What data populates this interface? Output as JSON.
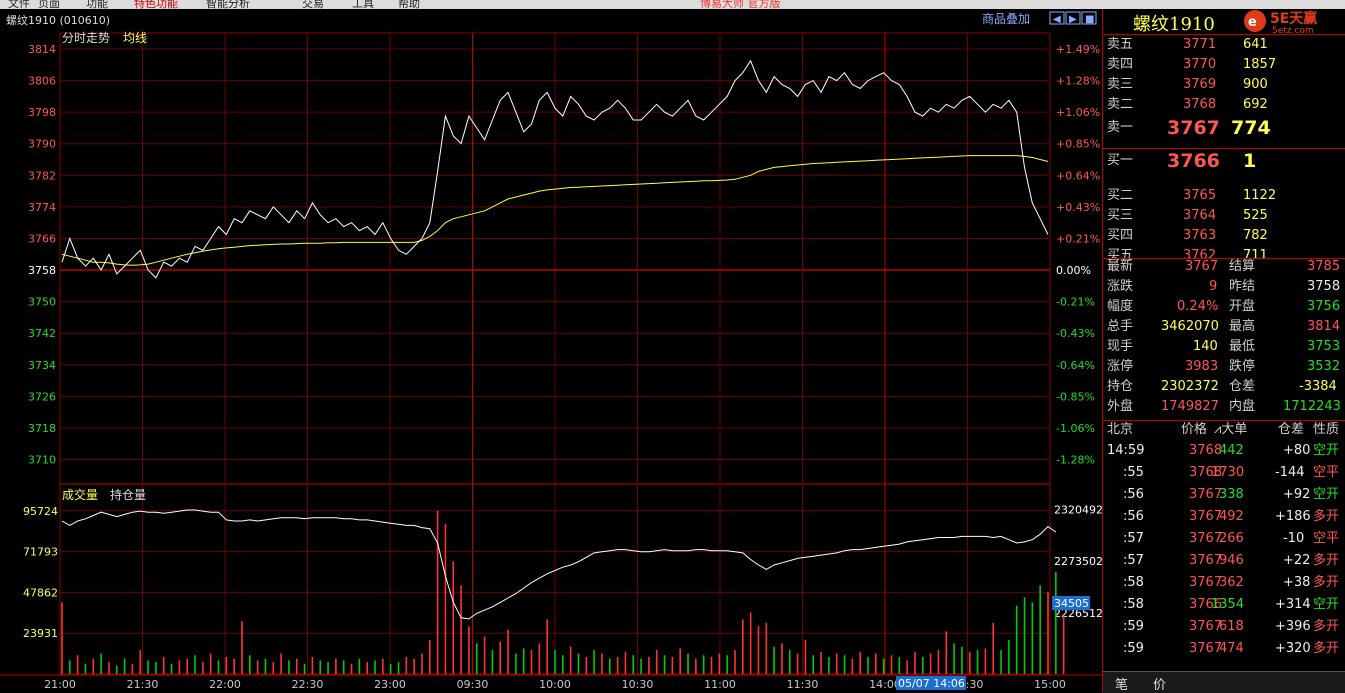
{
  "top_menu": [
    "文件",
    "页面",
    "功能",
    "特色功能",
    "智能分析",
    "交易",
    "工具",
    "帮助"
  ],
  "top_banner": "博易大师 官方版",
  "chart": {
    "title": "螺纹1910 (010610)",
    "legend_price": "分时走势",
    "legend_avg": "均线",
    "top_right_button": "商品叠加",
    "price_ticks": [
      "3814",
      "3806",
      "3798",
      "3790",
      "3782",
      "3774",
      "3766",
      "3758",
      "3750",
      "3742",
      "3734",
      "3726",
      "3718",
      "3710"
    ],
    "pct_ticks": [
      "+1.49%",
      "+1.28%",
      "+1.06%",
      "+0.85%",
      "+0.64%",
      "+0.43%",
      "+0.21%",
      "0.00%",
      "-0.21%",
      "-0.43%",
      "-0.64%",
      "-0.85%",
      "-1.06%",
      "-1.28%"
    ],
    "vol_legend_volume": "成交量",
    "vol_legend_oi": "持仓量",
    "vol_ticks_left": [
      "95724",
      "71793",
      "47862",
      "23931"
    ],
    "vol_ticks_right": [
      "2320492",
      "2273502",
      "2226512"
    ],
    "vol_current": "34505",
    "time_ticks": [
      "21:00",
      "21:30",
      "22:00",
      "22:30",
      "23:00",
      "09:30",
      "10:00",
      "10:30",
      "11:00",
      "11:30",
      "14:00",
      "14:30",
      "15:00"
    ],
    "cursor_label": "05/07 14:06",
    "colors": {
      "price_line": "#ffffff",
      "avg_line": "#ffff33",
      "grid": "#8b0000",
      "up": "#ff3333",
      "down": "#00cc00"
    }
  },
  "chart_data": {
    "type": "line",
    "price_axis": {
      "min": 3706,
      "max": 3814,
      "prev_settle": 3758
    },
    "price_series": [
      3760,
      3766,
      3761,
      3759,
      3761,
      3758,
      3762,
      3757,
      3759,
      3761,
      3763,
      3758,
      3756,
      3760,
      3759,
      3761,
      3760,
      3764,
      3763,
      3766,
      3769,
      3767,
      3771,
      3770,
      3773,
      3772,
      3771,
      3774,
      3772,
      3770,
      3773,
      3771,
      3775,
      3772,
      3770,
      3771,
      3769,
      3770,
      3768,
      3769,
      3767,
      3770,
      3766,
      3763,
      3762,
      3764,
      3766,
      3770,
      3783,
      3797,
      3792,
      3790,
      3797,
      3794,
      3791,
      3796,
      3801,
      3803,
      3798,
      3793,
      3795,
      3801,
      3803,
      3799,
      3797,
      3802,
      3800,
      3797,
      3796,
      3798,
      3799,
      3801,
      3799,
      3796,
      3796,
      3798,
      3800,
      3798,
      3797,
      3799,
      3801,
      3797,
      3796,
      3798,
      3800,
      3802,
      3806,
      3808,
      3811,
      3806,
      3803,
      3807,
      3805,
      3804,
      3802,
      3805,
      3806,
      3803,
      3807,
      3806,
      3808,
      3805,
      3804,
      3806,
      3807,
      3808,
      3806,
      3805,
      3802,
      3798,
      3797,
      3799,
      3798,
      3800,
      3799,
      3801,
      3802,
      3800,
      3798,
      3800,
      3799,
      3801,
      3798,
      3784,
      3775,
      3771,
      3767
    ],
    "avg_series": [
      3762,
      3761.5,
      3761,
      3760.5,
      3760,
      3760,
      3759.8,
      3759.5,
      3759.3,
      3759.2,
      3759.3,
      3759.5,
      3760,
      3760.5,
      3761,
      3761.5,
      3762,
      3762.4,
      3762.8,
      3763.1,
      3763.4,
      3763.6,
      3763.8,
      3764,
      3764.2,
      3764.3,
      3764.4,
      3764.5,
      3764.6,
      3764.6,
      3764.7,
      3764.8,
      3764.8,
      3764.8,
      3764.9,
      3764.9,
      3765,
      3765,
      3765,
      3765,
      3765,
      3765,
      3765,
      3765,
      3765,
      3765,
      3765.5,
      3766.5,
      3768,
      3770,
      3771,
      3771.5,
      3772,
      3772.5,
      3773,
      3774,
      3775,
      3776,
      3776.5,
      3777,
      3777.5,
      3778,
      3778.3,
      3778.5,
      3778.7,
      3778.9,
      3779,
      3779.1,
      3779.2,
      3779.3,
      3779.4,
      3779.5,
      3779.6,
      3779.7,
      3779.8,
      3779.9,
      3780,
      3780.1,
      3780.2,
      3780.3,
      3780.4,
      3780.5,
      3780.6,
      3780.6,
      3780.7,
      3780.8,
      3781,
      3781.5,
      3782,
      3783,
      3783.5,
      3784,
      3784.2,
      3784.4,
      3784.6,
      3784.8,
      3785,
      3785.1,
      3785.2,
      3785.3,
      3785.4,
      3785.5,
      3785.6,
      3785.7,
      3785.8,
      3785.9,
      3786,
      3786.1,
      3786.2,
      3786.3,
      3786.4,
      3786.5,
      3786.6,
      3786.7,
      3786.8,
      3786.9,
      3787,
      3787,
      3787,
      3787,
      3787,
      3787,
      3787,
      3786.8,
      3786.5,
      3786,
      3785.5
    ],
    "oi_axis": {
      "min": 2180000,
      "max": 2330000
    },
    "oi_series": [
      2310000,
      2306000,
      2310000,
      2312000,
      2315000,
      2318000,
      2316000,
      2314000,
      2316000,
      2318000,
      2319000,
      2318000,
      2318000,
      2317000,
      2318000,
      2319000,
      2320000,
      2320000,
      2319000,
      2318000,
      2318000,
      2311000,
      2310000,
      2310000,
      2311000,
      2310000,
      2311000,
      2312000,
      2313000,
      2313000,
      2313000,
      2312000,
      2313000,
      2313000,
      2313000,
      2313000,
      2312000,
      2312000,
      2311000,
      2311000,
      2310000,
      2309000,
      2308000,
      2307000,
      2306000,
      2306000,
      2304000,
      2303000,
      2290000,
      2260000,
      2236000,
      2222000,
      2221000,
      2226000,
      2229000,
      2232000,
      2236000,
      2240000,
      2244000,
      2249000,
      2254000,
      2258000,
      2262000,
      2265000,
      2268000,
      2270000,
      2273000,
      2277000,
      2281000,
      2282000,
      2283000,
      2284000,
      2284000,
      2283000,
      2282000,
      2282000,
      2283000,
      2284000,
      2283000,
      2283000,
      2283000,
      2284000,
      2284000,
      2283000,
      2283000,
      2283000,
      2282000,
      2281000,
      2275000,
      2270000,
      2266000,
      2270000,
      2272000,
      2274000,
      2276000,
      2277000,
      2278000,
      2279000,
      2280000,
      2281000,
      2283000,
      2284000,
      2284000,
      2285000,
      2286000,
      2287000,
      2288000,
      2289000,
      2291000,
      2292000,
      2293000,
      2294000,
      2295000,
      2295000,
      2295000,
      2296000,
      2296000,
      2296000,
      2296000,
      2295000,
      2296000,
      2293000,
      2290000,
      2291000,
      2293000,
      2298000,
      2305000,
      2300000
    ],
    "vol_axis": {
      "max": 95724
    },
    "volume_series": [
      42000,
      8000,
      11000,
      6000,
      9000,
      12000,
      7000,
      5000,
      9000,
      6000,
      14000,
      8000,
      7000,
      10000,
      6000,
      8000,
      9000,
      11000,
      7000,
      12000,
      8000,
      10000,
      9000,
      31000,
      11000,
      8000,
      9000,
      7000,
      12000,
      8000,
      9000,
      6000,
      10000,
      8000,
      7000,
      9000,
      8000,
      6000,
      9000,
      7000,
      8000,
      9000,
      6000,
      7000,
      10000,
      9000,
      12000,
      20000,
      95724,
      88000,
      66000,
      52000,
      28000,
      18000,
      22000,
      14000,
      19000,
      26000,
      12000,
      15000,
      14000,
      18000,
      32000,
      14000,
      11000,
      16000,
      12000,
      10000,
      14000,
      12000,
      9000,
      10000,
      13000,
      11000,
      9000,
      10000,
      14000,
      11000,
      10000,
      15000,
      12000,
      9000,
      11000,
      10000,
      12000,
      11000,
      14000,
      32000,
      36000,
      28000,
      30000,
      16000,
      18000,
      14000,
      12000,
      20000,
      11000,
      13000,
      10000,
      12000,
      11000,
      9000,
      13000,
      10000,
      12000,
      9000,
      11000,
      10000,
      8000,
      13000,
      10000,
      12000,
      14000,
      25000,
      18000,
      16000,
      13000,
      14000,
      15000,
      30000,
      14000,
      20000,
      40000,
      45000,
      42000,
      52000,
      48000,
      60000,
      34505
    ],
    "volume_dir": [
      1,
      0,
      1,
      0,
      1,
      0,
      1,
      0,
      0,
      1,
      1,
      0,
      0,
      1,
      0,
      1,
      1,
      0,
      1,
      1,
      0,
      1,
      1,
      1,
      0,
      1,
      0,
      1,
      1,
      0,
      1,
      0,
      1,
      0,
      0,
      1,
      0,
      1,
      0,
      1,
      0,
      1,
      0,
      0,
      1,
      1,
      1,
      1,
      1,
      1,
      1,
      1,
      1,
      0,
      1,
      0,
      1,
      1,
      0,
      0,
      1,
      1,
      1,
      0,
      0,
      1,
      0,
      1,
      0,
      1,
      0,
      1,
      1,
      0,
      0,
      1,
      1,
      0,
      1,
      1,
      0,
      1,
      0,
      1,
      1,
      0,
      1,
      1,
      1,
      1,
      1,
      0,
      1,
      0,
      1,
      1,
      0,
      1,
      0,
      1,
      0,
      1,
      1,
      0,
      1,
      0,
      1,
      0,
      1,
      1,
      0,
      1,
      1,
      1,
      0,
      0,
      1,
      0,
      1,
      1,
      0,
      0,
      0,
      0,
      0,
      0,
      1,
      0,
      1
    ]
  },
  "side": {
    "symbol": "螺纹1910",
    "logo": "5E天赢",
    "logo_sub": "5etz.com",
    "asks": [
      {
        "label": "卖五",
        "price": "3771",
        "qty": "641"
      },
      {
        "label": "卖四",
        "price": "3770",
        "qty": "1857"
      },
      {
        "label": "卖三",
        "price": "3769",
        "qty": "900"
      },
      {
        "label": "卖二",
        "price": "3768",
        "qty": "692"
      },
      {
        "label": "卖一",
        "price": "3767",
        "qty": "774"
      }
    ],
    "bids": [
      {
        "label": "买一",
        "price": "3766",
        "qty": "1"
      },
      {
        "label": "买二",
        "price": "3765",
        "qty": "1122"
      },
      {
        "label": "买三",
        "price": "3764",
        "qty": "525"
      },
      {
        "label": "买四",
        "price": "3763",
        "qty": "782"
      },
      {
        "label": "买五",
        "price": "3762",
        "qty": "711"
      }
    ],
    "stats": [
      {
        "l1": "最新",
        "v1": "3767",
        "c1": "red",
        "l2": "结算",
        "v2": "3785",
        "c2": "red"
      },
      {
        "l1": "涨跌",
        "v1": "9",
        "c1": "red",
        "l2": "昨结",
        "v2": "3758",
        "c2": "wht"
      },
      {
        "l1": "幅度",
        "v1": "0.24%",
        "c1": "red",
        "l2": "开盘",
        "v2": "3756",
        "c2": "grn"
      },
      {
        "l1": "总手",
        "v1": "3462070",
        "c1": "yel",
        "l2": "最高",
        "v2": "3814",
        "c2": "red"
      },
      {
        "l1": "现手",
        "v1": "140",
        "c1": "yel",
        "l2": "最低",
        "v2": "3753",
        "c2": "grn"
      },
      {
        "l1": "涨停",
        "v1": "3983",
        "c1": "red",
        "l2": "跌停",
        "v2": "3532",
        "c2": "grn"
      },
      {
        "l1": "持仓",
        "v1": "2302372",
        "c1": "yel",
        "l2": "仓差",
        "v2": "-3384",
        "c2": "yel"
      },
      {
        "l1": "外盘",
        "v1": "1749827",
        "c1": "red",
        "l2": "内盘",
        "v2": "1712243",
        "c2": "grn"
      }
    ],
    "ticks_header": {
      "time": "北京",
      "price": "价格",
      "vol": "⩘大单",
      "oi": "仓差",
      "nature": "性质"
    },
    "ticks": [
      {
        "time": "14:59",
        "price": "3768",
        "pc": "red",
        "vol": "442",
        "vc": "grn",
        "oi": "+80",
        "nature": "空开",
        "nc": "grn"
      },
      {
        "time": ":55",
        "price": "3768",
        "pc": "red",
        "vol": "1730",
        "vc": "red",
        "oi": "-144",
        "nature": "空平",
        "nc": "red"
      },
      {
        "time": ":56",
        "price": "3767",
        "pc": "red",
        "vol": "338",
        "vc": "grn",
        "oi": "+92",
        "nature": "空开",
        "nc": "grn"
      },
      {
        "time": ":56",
        "price": "3767",
        "pc": "red",
        "vol": "492",
        "vc": "red",
        "oi": "+186",
        "nature": "多开",
        "nc": "red"
      },
      {
        "time": ":57",
        "price": "3767",
        "pc": "red",
        "vol": "266",
        "vc": "red",
        "oi": "-10",
        "nature": "空平",
        "nc": "red"
      },
      {
        "time": ":57",
        "price": "3767",
        "pc": "red",
        "vol": "946",
        "vc": "red",
        "oi": "+22",
        "nature": "多开",
        "nc": "red"
      },
      {
        "time": ":58",
        "price": "3767",
        "pc": "red",
        "vol": "362",
        "vc": "red",
        "oi": "+38",
        "nature": "多开",
        "nc": "red"
      },
      {
        "time": ":58",
        "price": "3766",
        "pc": "red",
        "vol": "1354",
        "vc": "grn",
        "oi": "+314",
        "nature": "空开",
        "nc": "grn"
      },
      {
        "time": ":59",
        "price": "3767",
        "pc": "red",
        "vol": "618",
        "vc": "red",
        "oi": "+396",
        "nature": "多开",
        "nc": "red"
      },
      {
        "time": ":59",
        "price": "3767",
        "pc": "red",
        "vol": "474",
        "vc": "red",
        "oi": "+320",
        "nature": "多开",
        "nc": "red"
      }
    ],
    "footer_tabs": [
      "笔",
      "价"
    ]
  }
}
